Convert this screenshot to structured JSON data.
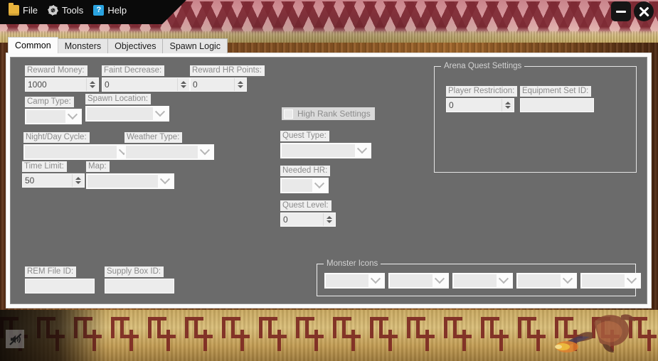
{
  "window": {
    "minimize_label": "minimize",
    "close_label": "close"
  },
  "menubar": {
    "items": [
      {
        "label": "File",
        "icon": "folder-icon"
      },
      {
        "label": "Tools",
        "icon": "gear-icon"
      },
      {
        "label": "Help",
        "icon": "help-question-icon"
      }
    ]
  },
  "tabs": [
    {
      "label": "Common",
      "active": true
    },
    {
      "label": "Monsters",
      "active": false
    },
    {
      "label": "Objectives",
      "active": false
    },
    {
      "label": "Spawn Logic",
      "active": false
    }
  ],
  "common_tab": {
    "reward_money": {
      "label": "Reward Money:",
      "value": "1000"
    },
    "faint_decrease": {
      "label": "Faint Decrease:",
      "value": "0"
    },
    "reward_hr_points": {
      "label": "Reward HR Points:",
      "value": "0"
    },
    "camp_type": {
      "label": "Camp Type:",
      "value": ""
    },
    "spawn_location": {
      "label": "Spawn Location:",
      "value": ""
    },
    "night_day_cycle": {
      "label": "Night/Day Cycle:",
      "value": ""
    },
    "weather_type": {
      "label": "Weather Type:",
      "value": ""
    },
    "time_limit": {
      "label": "Time Limit:",
      "value": "50"
    },
    "map": {
      "label": "Map:",
      "value": ""
    },
    "high_rank_settings": {
      "label": "High Rank Settings",
      "checked": false
    },
    "quest_type": {
      "label": "Quest Type:",
      "value": ""
    },
    "needed_hr": {
      "label": "Needed HR:",
      "value": ""
    },
    "quest_level": {
      "label": "Quest Level:",
      "value": "0"
    },
    "rem_file_id": {
      "label": "REM File ID:",
      "value": ""
    },
    "supply_box_id": {
      "label": "Supply Box ID:",
      "value": ""
    }
  },
  "arena_quest_settings": {
    "title": "Arena Quest Settings",
    "player_restriction": {
      "label": "Player Restriction:",
      "value": "0"
    },
    "equipment_set_id": {
      "label": "Equipment Set ID:",
      "value": ""
    }
  },
  "monster_icons": {
    "title": "Monster Icons",
    "slots": [
      {
        "value": ""
      },
      {
        "value": ""
      },
      {
        "value": ""
      },
      {
        "value": ""
      },
      {
        "value": ""
      }
    ]
  },
  "statusbar": {
    "mute_icon": "speaker-muted-icon"
  },
  "colors": {
    "panel": "#6b6b6b",
    "frame": "#fbfbfb",
    "label_bg": "#efefef",
    "label_text": "#8b8b8b",
    "input_bg": "#ededed",
    "banner_red": "#79242e",
    "banner_pink": "#d89ba0",
    "meander_red": "#7d2a22",
    "sand": "#c8a85f",
    "help_blue": "#2aa3e0",
    "folder_yellow": "#e8b33c"
  }
}
